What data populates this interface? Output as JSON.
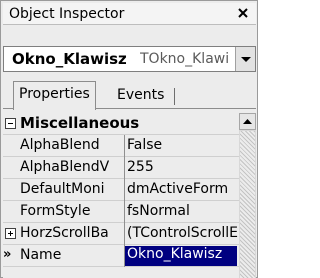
{
  "window": {
    "title": "Object Inspector"
  },
  "object_selector": {
    "object_name": "Okno_Klawisz",
    "class_name": "TOkno_Klawi"
  },
  "tabs": [
    {
      "label": "Properties",
      "active": true
    },
    {
      "label": "Events",
      "active": false
    }
  ],
  "grid": {
    "category": "Miscellaneous",
    "rows": [
      {
        "name": "AlphaBlend",
        "value": "False"
      },
      {
        "name": "AlphaBlendV",
        "value": "255"
      },
      {
        "name": "DefaultMoni",
        "value": "dmActiveForm"
      },
      {
        "name": "FormStyle",
        "value": "fsNormal"
      },
      {
        "name": "HorzScrollBa",
        "value": "(TControlScrollE"
      },
      {
        "name": "Name",
        "value": "Okno_Klawisz"
      }
    ]
  },
  "colors": {
    "selection": "#000080",
    "panel": "#ececec"
  }
}
